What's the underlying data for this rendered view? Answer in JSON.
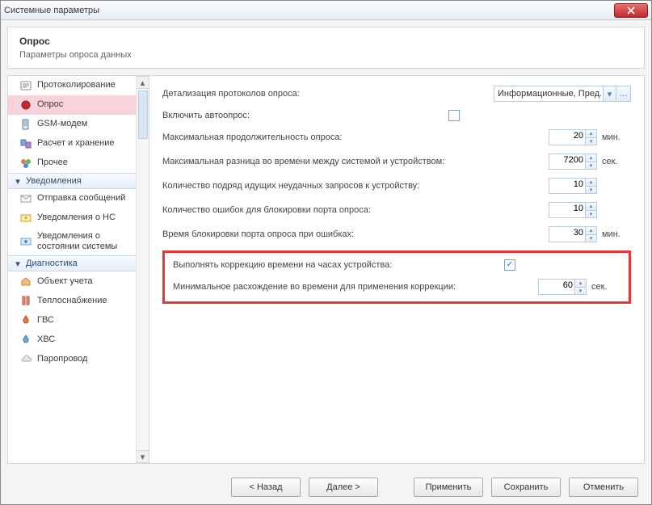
{
  "window": {
    "title": "Системные параметры"
  },
  "header": {
    "title": "Опрос",
    "subtitle": "Параметры опроса данных"
  },
  "sidebar": {
    "items": [
      {
        "label": "Протоколирование"
      },
      {
        "label": "Опрос"
      },
      {
        "label": "GSM-модем"
      },
      {
        "label": "Расчет и хранение"
      },
      {
        "label": "Прочее"
      }
    ],
    "group_notify": {
      "label": "Уведомления"
    },
    "notify_items": [
      {
        "label": "Отправка сообщений"
      },
      {
        "label": "Уведомления о НС"
      },
      {
        "label": "Уведомления о состоянии системы"
      }
    ],
    "group_diag": {
      "label": "Диагностика"
    },
    "diag_items": [
      {
        "label": "Объект учета"
      },
      {
        "label": "Теплоснабжение"
      },
      {
        "label": "ГВС"
      },
      {
        "label": "ХВС"
      },
      {
        "label": "Паропровод"
      }
    ]
  },
  "fields": {
    "detail_label": "Детализация протоколов опроса:",
    "detail_value": "Информационные, Пред...",
    "autopoll_label": "Включить автоопрос:",
    "maxdur_label": "Максимальная продолжительность опроса:",
    "maxdur_value": "20",
    "maxdur_unit": "мин.",
    "timediff_label": "Максимальная разница во времени между системой и устройством:",
    "timediff_value": "7200",
    "timediff_unit": "сек.",
    "failcount_label": "Количество подряд идущих неудачных запросов к устройству:",
    "failcount_value": "10",
    "errcount_label": "Количество ошибок для блокировки порта опроса:",
    "errcount_value": "10",
    "blocktime_label": "Время блокировки порта опроса при ошибках:",
    "blocktime_value": "30",
    "blocktime_unit": "мин.",
    "correction_label": "Выполнять коррекцию времени на часах устройства:",
    "mindiv_label": "Минимальное расхождение во времени для применения коррекции:",
    "mindiv_value": "60",
    "mindiv_unit": "сек."
  },
  "buttons": {
    "back": "< Назад",
    "next": "Далее >",
    "apply": "Применить",
    "save": "Сохранить",
    "cancel": "Отменить"
  }
}
